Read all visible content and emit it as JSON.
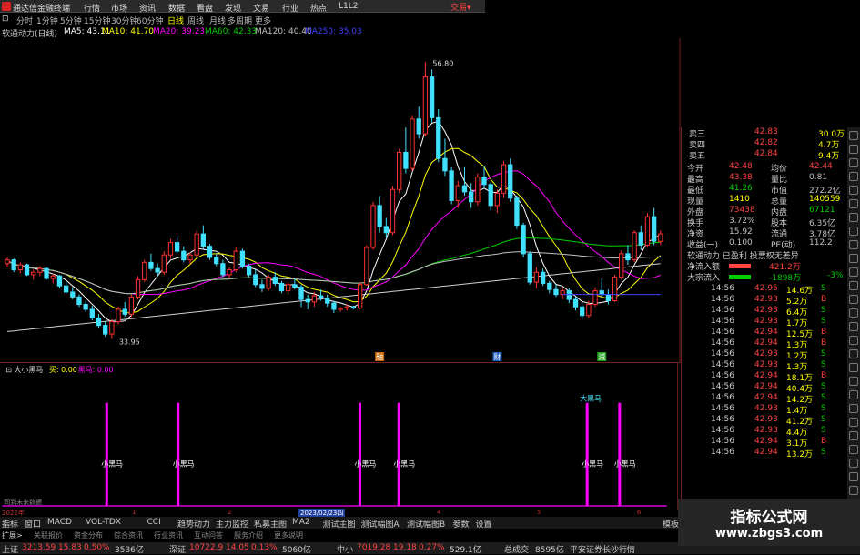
{
  "app": {
    "title": "通达信金融终端",
    "trade": "交易▾"
  },
  "menu": [
    "行情",
    "市场",
    "资讯",
    "数据",
    "看盘",
    "发现",
    "文易",
    "行业",
    "热点",
    "L1L2"
  ],
  "periods": [
    {
      "label": "分时",
      "active": false
    },
    {
      "label": "1分钟",
      "active": false
    },
    {
      "label": "5分钟",
      "active": false
    },
    {
      "label": "15分钟",
      "active": false
    },
    {
      "label": "30分钟",
      "active": false
    },
    {
      "label": "60分钟",
      "active": false
    },
    {
      "label": "日线",
      "active": true
    },
    {
      "label": "周线",
      "active": false
    },
    {
      "label": "月线",
      "active": false
    },
    {
      "label": "多周期",
      "active": false
    },
    {
      "label": "更多",
      "active": false
    }
  ],
  "ma_bar": {
    "stock": "软通动力(日线)",
    "items": [
      {
        "label": "MA5: 43.11",
        "color": "#ffffff"
      },
      {
        "label": "MA10: 41.70",
        "color": "#ffff00"
      },
      {
        "label": "MA20: 39.23",
        "color": "#ff00ff"
      },
      {
        "label": "MA60: 42.33",
        "color": "#00cc00"
      },
      {
        "label": "MA120: 40.40",
        "color": "#c0c0c0"
      },
      {
        "label": "MA250: 35.03",
        "color": "#4040ff"
      }
    ]
  },
  "price_labels": {
    "high": "56.80",
    "low": "33.95"
  },
  "event_icons": [
    {
      "label": "融",
      "color": "#cc6600"
    },
    {
      "label": "财",
      "color": "#2060c0"
    },
    {
      "label": "減",
      "color": "#20a020"
    }
  ],
  "chart_data": {
    "type": "candlestick",
    "ylim": [
      34,
      58
    ],
    "y_ticks": [
      "48.00",
      "46.00",
      "44.00",
      "42.00",
      "40.00",
      "38.00",
      "36.00",
      "34.00"
    ],
    "high_label": "56.80",
    "low_label": "33.95",
    "candles": [
      [
        40.5,
        41.0,
        40.2,
        40.8
      ],
      [
        40.8,
        40.9,
        39.8,
        40.0
      ],
      [
        40.0,
        40.6,
        39.7,
        40.4
      ],
      [
        40.4,
        40.5,
        39.5,
        39.6
      ],
      [
        39.6,
        40.0,
        39.2,
        39.8
      ],
      [
        39.8,
        40.3,
        39.5,
        40.1
      ],
      [
        40.1,
        40.2,
        39.2,
        39.3
      ],
      [
        39.3,
        39.7,
        38.9,
        39.5
      ],
      [
        39.5,
        39.6,
        38.5,
        38.7
      ],
      [
        38.7,
        39.0,
        38.0,
        38.2
      ],
      [
        38.2,
        38.6,
        37.6,
        37.8
      ],
      [
        37.8,
        38.0,
        37.0,
        37.2
      ],
      [
        37.2,
        37.5,
        36.6,
        36.8
      ],
      [
        36.8,
        37.1,
        35.9,
        36.1
      ],
      [
        36.1,
        36.4,
        35.3,
        35.5
      ],
      [
        35.5,
        35.8,
        34.6,
        34.8
      ],
      [
        34.8,
        36.0,
        34.4,
        35.8
      ],
      [
        35.8,
        37.0,
        35.6,
        36.8
      ],
      [
        36.8,
        37.4,
        36.2,
        36.4
      ],
      [
        36.4,
        38.0,
        36.2,
        37.8
      ],
      [
        37.8,
        39.5,
        37.6,
        39.2
      ],
      [
        39.2,
        40.8,
        39.0,
        40.6
      ],
      [
        40.6,
        41.3,
        39.9,
        40.1
      ],
      [
        40.1,
        40.5,
        39.5,
        39.8
      ],
      [
        39.8,
        41.5,
        39.6,
        41.2
      ],
      [
        41.2,
        42.5,
        40.9,
        42.2
      ],
      [
        42.2,
        42.8,
        41.3,
        41.5
      ],
      [
        41.5,
        41.9,
        40.6,
        40.8
      ],
      [
        40.8,
        41.4,
        40.5,
        41.2
      ],
      [
        41.2,
        43.2,
        41.0,
        42.9
      ],
      [
        42.9,
        43.6,
        41.7,
        41.9
      ],
      [
        41.9,
        42.1,
        40.8,
        41.0
      ],
      [
        41.0,
        41.3,
        40.3,
        40.5
      ],
      [
        40.5,
        40.8,
        39.4,
        39.6
      ],
      [
        39.6,
        40.2,
        39.3,
        40.0
      ],
      [
        40.0,
        41.8,
        39.8,
        41.5
      ],
      [
        41.5,
        41.7,
        40.1,
        40.3
      ],
      [
        40.3,
        40.5,
        39.4,
        39.6
      ],
      [
        39.6,
        40.0,
        38.6,
        38.8
      ],
      [
        38.8,
        39.2,
        38.2,
        38.5
      ],
      [
        38.5,
        39.6,
        38.3,
        39.4
      ],
      [
        39.4,
        39.8,
        38.7,
        38.9
      ],
      [
        38.9,
        39.1,
        38.1,
        38.3
      ],
      [
        38.3,
        39.0,
        38.0,
        38.8
      ],
      [
        38.8,
        39.3,
        38.4,
        38.6
      ],
      [
        38.6,
        38.8,
        37.0,
        37.6
      ],
      [
        37.6,
        38.0,
        36.8,
        37.4
      ],
      [
        37.4,
        38.2,
        37.0,
        37.9
      ],
      [
        37.9,
        38.4,
        37.5,
        37.7
      ],
      [
        37.7,
        38.0,
        37.0,
        37.3
      ],
      [
        37.3,
        37.5,
        36.5,
        36.8
      ],
      [
        36.8,
        37.0,
        36.6,
        36.9
      ],
      [
        36.9,
        37.2,
        36.7,
        37.0
      ],
      [
        37.0,
        37.1,
        36.8,
        36.9
      ],
      [
        36.9,
        39.0,
        36.8,
        38.8
      ],
      [
        38.8,
        42.0,
        38.7,
        41.8
      ],
      [
        41.8,
        45.5,
        41.6,
        45.2
      ],
      [
        45.2,
        46.0,
        43.0,
        43.5
      ],
      [
        43.5,
        44.2,
        42.6,
        43.0
      ],
      [
        43.0,
        46.8,
        42.8,
        46.5
      ],
      [
        46.5,
        49.8,
        46.2,
        49.5
      ],
      [
        49.5,
        51.5,
        47.8,
        48.2
      ],
      [
        48.2,
        52.5,
        48.0,
        52.2
      ],
      [
        52.2,
        53.2,
        50.6,
        51.0
      ],
      [
        51.0,
        56.8,
        50.8,
        55.6
      ],
      [
        55.6,
        56.2,
        51.9,
        52.3
      ],
      [
        52.3,
        53.0,
        48.7,
        49.0
      ],
      [
        49.0,
        50.6,
        47.6,
        48.0
      ],
      [
        48.0,
        48.3,
        45.3,
        45.6
      ],
      [
        45.6,
        47.2,
        45.0,
        46.8
      ],
      [
        46.8,
        48.3,
        46.0,
        46.3
      ],
      [
        46.3,
        47.0,
        45.0,
        45.5
      ],
      [
        45.5,
        47.8,
        45.2,
        47.5
      ],
      [
        47.5,
        48.4,
        46.6,
        46.9
      ],
      [
        46.9,
        47.1,
        44.8,
        45.2
      ],
      [
        45.2,
        46.5,
        44.6,
        46.2
      ],
      [
        46.2,
        48.8,
        45.8,
        48.5
      ],
      [
        48.5,
        49.0,
        45.5,
        45.8
      ],
      [
        45.8,
        46.0,
        43.3,
        43.6
      ],
      [
        43.6,
        43.8,
        41.0,
        41.3
      ],
      [
        41.3,
        41.5,
        38.8,
        39.0
      ],
      [
        39.0,
        40.2,
        38.5,
        39.8
      ],
      [
        39.8,
        40.1,
        38.7,
        38.9
      ],
      [
        38.9,
        39.1,
        38.1,
        38.4
      ],
      [
        38.4,
        38.8,
        37.8,
        38.0
      ],
      [
        38.0,
        38.6,
        37.6,
        38.3
      ],
      [
        38.3,
        38.5,
        37.3,
        37.6
      ],
      [
        37.6,
        37.8,
        36.7,
        37.0
      ],
      [
        37.0,
        37.4,
        36.0,
        36.3
      ],
      [
        36.3,
        37.5,
        36.1,
        37.2
      ],
      [
        37.2,
        38.6,
        37.0,
        38.3
      ],
      [
        38.3,
        39.3,
        37.8,
        38.0
      ],
      [
        38.0,
        38.4,
        37.2,
        37.5
      ],
      [
        37.5,
        39.6,
        37.4,
        39.4
      ],
      [
        39.4,
        41.6,
        39.2,
        41.3
      ],
      [
        41.3,
        42.0,
        40.4,
        40.8
      ],
      [
        40.8,
        43.2,
        40.6,
        43.0
      ],
      [
        43.0,
        43.6,
        41.6,
        42.0
      ],
      [
        42.0,
        44.6,
        41.8,
        44.3
      ],
      [
        44.3,
        45.0,
        42.0,
        42.3
      ],
      [
        42.3,
        43.2,
        42.0,
        42.9
      ]
    ],
    "ma_lines": [
      "MA5",
      "MA10",
      "MA20",
      "MA60",
      "MA120"
    ]
  },
  "indicator": {
    "name": "大小黑马",
    "legend": [
      {
        "label": "买: 0.00",
        "color": "#ff0"
      },
      {
        "label": "黑马: 0.00",
        "color": "#f0f"
      }
    ],
    "y_ticks": [
      "80.00",
      "70.00",
      "60.00",
      "50.00",
      "40.00",
      "30.00",
      "20.00",
      "10.00"
    ],
    "signals": [
      {
        "index": 15,
        "label": "小黑马"
      },
      {
        "index": 26,
        "label": "小黑马"
      },
      {
        "index": 54,
        "label": "小黑马"
      },
      {
        "index": 60,
        "label": "小黑马"
      },
      {
        "index": 89,
        "label": "小黑马"
      },
      {
        "index": 94,
        "label": "小黑马"
      }
    ],
    "top_label": "大黑马",
    "footnote": "同到未来数据",
    "date_label": "2023/02/23四",
    "axis_marks": [
      "2022年",
      "1",
      "2",
      "3",
      "4",
      "5",
      "6"
    ]
  },
  "quotes": {
    "book": [
      {
        "label": "卖三",
        "price": "42.83",
        "vol": "30.0万"
      },
      {
        "label": "卖四",
        "price": "42.82",
        "vol": "4.7万"
      },
      {
        "label": "卖五",
        "price": "42.84",
        "vol": "9.4万"
      }
    ],
    "stats": [
      {
        "l1": "今开",
        "v1": "42.48",
        "c1": "#ff4444",
        "l2": "均价",
        "v2": "42.44",
        "c2": "#ff4444"
      },
      {
        "l1": "最高",
        "v1": "43.38",
        "c1": "#ff4444",
        "l2": "量比",
        "v2": "0.81",
        "c2": "#c0c0c0"
      },
      {
        "l1": "最低",
        "v1": "41.26",
        "c1": "#00cc00",
        "l2": "市值",
        "v2": "272.2亿",
        "c2": "#c0c0c0"
      },
      {
        "l1": "现量",
        "v1": "1410",
        "c1": "#ffff00",
        "l2": "总量",
        "v2": "140559",
        "c2": "#ffff00"
      },
      {
        "l1": "外盘",
        "v1": "73438",
        "c1": "#ff4444",
        "l2": "内盘",
        "v2": "67121",
        "c2": "#00cc00"
      },
      {
        "l1": "换手",
        "v1": "3.72%",
        "c1": "#c0c0c0",
        "l2": "股本",
        "v2": "6.35亿",
        "c2": "#c0c0c0"
      },
      {
        "l1": "净资",
        "v1": "15.92",
        "c1": "#c0c0c0",
        "l2": "流通",
        "v2": "3.78亿",
        "c2": "#c0c0c0"
      },
      {
        "l1": "收益(一)",
        "v1": "0.100",
        "c1": "#c0c0c0",
        "l2": "PE(动)",
        "v2": "112.2",
        "c2": "#c0c0c0"
      }
    ],
    "flags": "软通动力  已盈利  投票权无差异",
    "flow": [
      {
        "label": "净流入额",
        "val": "421.2万",
        "color": "#ff4444"
      },
      {
        "label": "大宗流入",
        "val": "-1898万",
        "color": "#00cc00",
        "pct": "-3%"
      }
    ],
    "ticks": [
      {
        "t": "14:56",
        "p": "42.95",
        "v": "14.6万",
        "s": "S"
      },
      {
        "t": "14:56",
        "p": "42.93",
        "v": "5.2万",
        "s": "B"
      },
      {
        "t": "14:56",
        "p": "42.93",
        "v": "6.4万",
        "s": "S"
      },
      {
        "t": "14:56",
        "p": "42.93",
        "v": "1.7万",
        "s": "S"
      },
      {
        "t": "14:56",
        "p": "42.94",
        "v": "12.5万",
        "s": "B"
      },
      {
        "t": "14:56",
        "p": "42.94",
        "v": "1.3万",
        "s": "B"
      },
      {
        "t": "14:56",
        "p": "42.93",
        "v": "1.2万",
        "s": "S"
      },
      {
        "t": "14:56",
        "p": "42.93",
        "v": "1.3万",
        "s": "S"
      },
      {
        "t": "14:56",
        "p": "42.94",
        "v": "18.1万",
        "s": "B"
      },
      {
        "t": "14:56",
        "p": "42.94",
        "v": "40.4万",
        "s": "S"
      },
      {
        "t": "14:56",
        "p": "42.94",
        "v": "14.2万",
        "s": "S"
      },
      {
        "t": "14:56",
        "p": "42.93",
        "v": "1.4万",
        "s": "S"
      },
      {
        "t": "14:56",
        "p": "42.93",
        "v": "41.2万",
        "s": "S"
      },
      {
        "t": "14:56",
        "p": "42.93",
        "v": "4.4万",
        "s": "S"
      },
      {
        "t": "14:56",
        "p": "42.94",
        "v": "3.1万",
        "s": "B"
      },
      {
        "t": "14:56",
        "p": "42.94",
        "v": "13.2万",
        "s": "S"
      }
    ]
  },
  "tabs": [
    "指标",
    "窗口",
    "MACD",
    "VOL-TDX",
    "CCI",
    "趋势动力",
    "主力监控",
    "私募主图",
    "MA2",
    "测试主图",
    "测试幅图A",
    "测试幅图B",
    "参数",
    "设置"
  ],
  "bottom_tabs": [
    "扩展>",
    "关联报价",
    "资金分布",
    "综合资讯",
    "行业资讯",
    "互动问答",
    "服务介绍",
    "更多说明"
  ],
  "status": [
    {
      "label": "上证",
      "val": "3213.59",
      "chg": "15.83",
      "pct": "0.50%",
      "amt": "3536亿"
    },
    {
      "label": "深证",
      "val": "10722.9",
      "chg": "14.05",
      "pct": "0.13%",
      "amt": "5060亿"
    },
    {
      "label": "中小",
      "val": "7019.28",
      "chg": "19.18",
      "pct": "0.27%",
      "amt": "529.1亿"
    }
  ],
  "status_extra": {
    "label": "总成交",
    "amt": "8595亿",
    "broker": "平安证券长沙行情"
  },
  "watermark": {
    "line1": "指标公式网",
    "line2": "www.zbgs3.com"
  },
  "side_right_label": "模板"
}
